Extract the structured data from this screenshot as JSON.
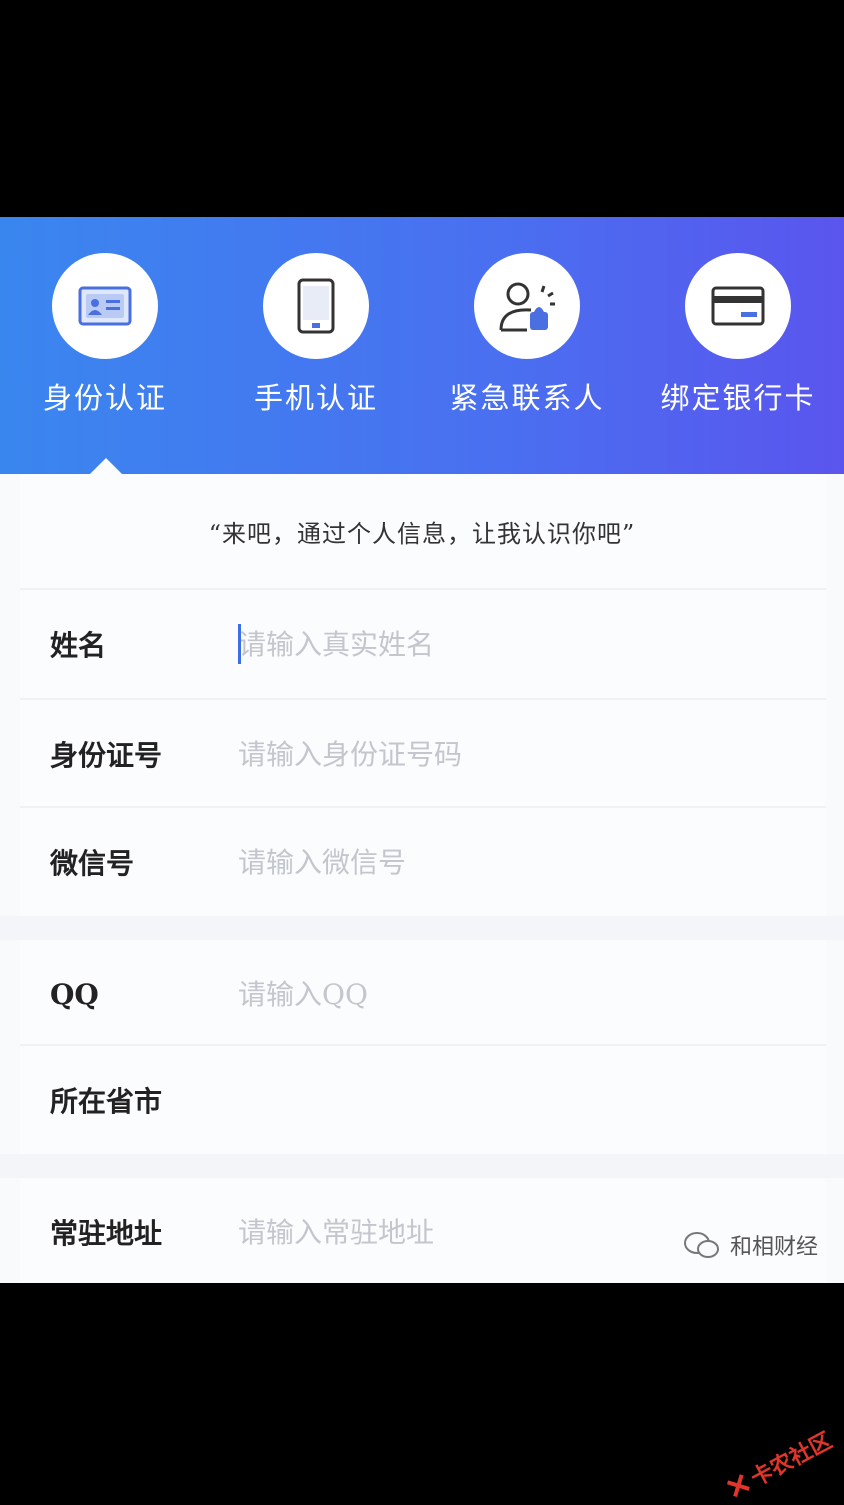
{
  "steps": [
    {
      "label": "身份认证",
      "icon": "id-card-icon"
    },
    {
      "label": "手机认证",
      "icon": "phone-icon"
    },
    {
      "label": "紧急联系人",
      "icon": "contact-person-icon"
    },
    {
      "label": "绑定银行卡",
      "icon": "bank-card-icon"
    }
  ],
  "quote": "“来吧，通过个人信息，让我认识你吧”",
  "form": {
    "name": {
      "label": "姓名",
      "placeholder": "请输入真实姓名"
    },
    "id_number": {
      "label": "身份证号",
      "placeholder": "请输入身份证号码"
    },
    "wechat": {
      "label": "微信号",
      "placeholder": "请输入微信号"
    },
    "qq": {
      "label": "QQ",
      "placeholder": "请输入QQ"
    },
    "province_city": {
      "label": "所在省市"
    },
    "address": {
      "label": "常驻地址",
      "placeholder": "请输入常驻地址"
    }
  },
  "watermark": "和相财经",
  "corner_mark": "卡农社区",
  "colors": {
    "gradient_start": "#3a86ef",
    "gradient_end": "#5a55ee",
    "icon_blue": "#4a6fe0",
    "caret": "#3a6fe8"
  }
}
